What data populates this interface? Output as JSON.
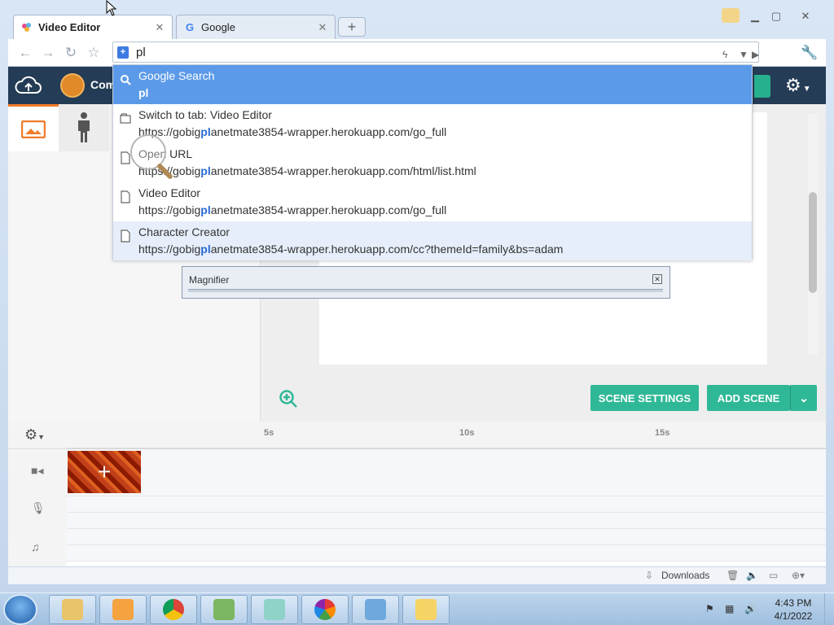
{
  "browser": {
    "tabs": [
      {
        "label": "Video Editor",
        "active": true
      },
      {
        "label": "Google",
        "active": false
      }
    ],
    "omnibox_value": "pl"
  },
  "dropdown": {
    "items": [
      {
        "title": "Google Search",
        "url": "pl",
        "icon": "search-icon"
      },
      {
        "title": "Switch to tab: Video Editor",
        "url_pre": "https://gobig",
        "url_bold": "pl",
        "url_post": "anetmate3854-wrapper.herokuapp.com/go_full",
        "icon": "tab-icon"
      },
      {
        "title": "Open URL",
        "url_pre": "https://gobig",
        "url_bold": "pl",
        "url_post": "anetmate3854-wrapper.herokuapp.com/html/list.html",
        "icon": "page-icon"
      },
      {
        "title": "Video Editor",
        "url_pre": "https://gobig",
        "url_bold": "pl",
        "url_post": "anetmate3854-wrapper.herokuapp.com/go_full",
        "icon": "page-icon"
      },
      {
        "title": "Character Creator",
        "url_pre": "https://gobig",
        "url_bold": "pl",
        "url_post": "anetmate3854-wrapper.herokuapp.com/cc?themeId=family&bs=adam",
        "icon": "page-icon"
      }
    ]
  },
  "magnifier": {
    "title": "Magnifier"
  },
  "app": {
    "appbar_label": "Com",
    "scene_settings": "SCENE SETTINGS",
    "add_scene": "ADD SCENE",
    "ruler": [
      "5s",
      "10s",
      "15s"
    ]
  },
  "statusbar": {
    "downloads": "Downloads"
  },
  "taskbar": {
    "time": "4:43 PM",
    "date": "4/1/2022"
  },
  "colors": {
    "accent_teal": "#2fb896",
    "appbar": "#243c55",
    "selection": "#5b9ae8",
    "orange": "#f07c2a"
  }
}
